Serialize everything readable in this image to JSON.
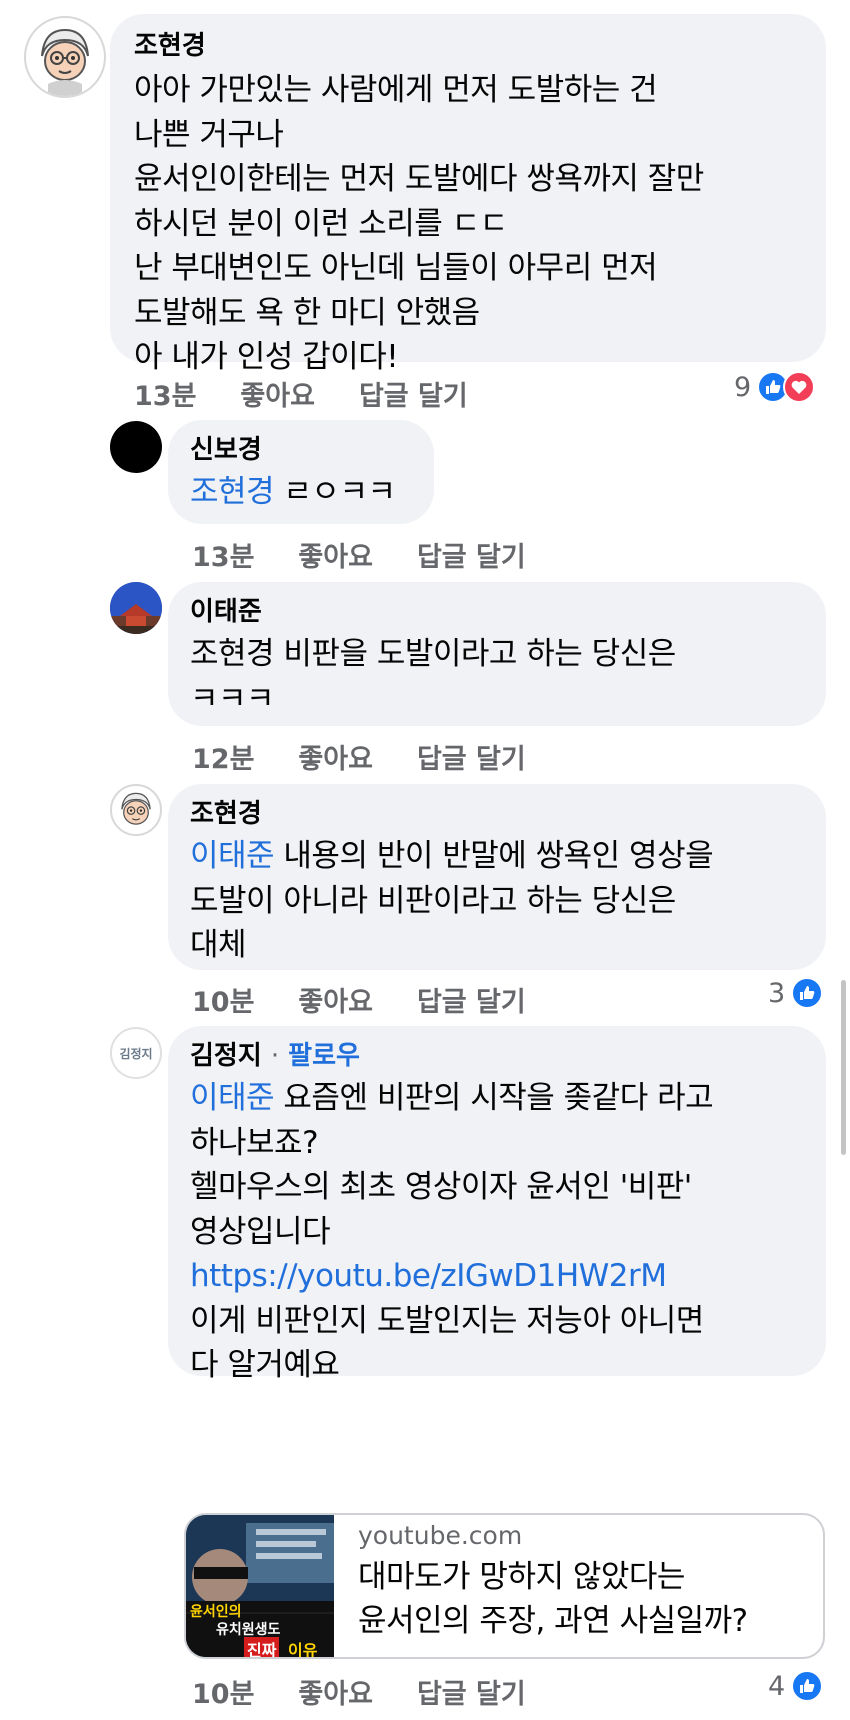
{
  "comments": [
    {
      "author": "조현경",
      "text": "아아 가만있는 사람에게 먼저 도발하는 건\n나쁜 거구나\n윤서인이한테는 먼저 도발에다 쌍욕까지 잘만\n하시던 분이 이런 소리를 ㄷㄷ\n난 부대변인도 아닌데 님들이 아무리 먼저\n도발해도 욕 한 마디 안했음\n아 내가 인성 갑이다!",
      "time": "13분",
      "like": "좋아요",
      "reply": "답글 달기",
      "reactions_count": "9"
    },
    {
      "author": "신보경",
      "mention": "조현경",
      "text": " ㄹㅇㅋㅋ",
      "time": "13분",
      "like": "좋아요",
      "reply": "답글 달기"
    },
    {
      "author": "이태준",
      "text": "조현경 비판을 도발이라고 하는 당신은\nㅋㅋㅋ",
      "time": "12분",
      "like": "좋아요",
      "reply": "답글 달기"
    },
    {
      "author": "조현경",
      "mention": "이태준",
      "text": " 내용의 반이 반말에 쌍욕인 영상을\n도발이 아니라 비판이라고 하는 당신은\n대체",
      "time": "10분",
      "like": "좋아요",
      "reply": "답글 달기",
      "reactions_count": "3"
    },
    {
      "author": "김정지",
      "separator": "·",
      "follow": "팔로우",
      "avatar_text": "김정지",
      "mention": "이태준",
      "text": " 요즘엔 비판의 시작을 좆같다 라고\n하나보죠?\n헬마우스의 최초 영상이자 윤서인 '비판'\n영상입니다",
      "link": "https://youtu.be/zIGwD1HW2rM",
      "text2": "이게 비판인지 도발인지는 저능아 아니면\n다 알거예요",
      "preview": {
        "domain": "youtube.com",
        "title": "대마도가 망하지 않았다는\n윤서인의 주장, 과연 사실일까?",
        "thumb_texts": [
          "윤서인의",
          "유치원생도",
          "진짜",
          "이유"
        ]
      },
      "time": "10분",
      "like": "좋아요",
      "reply": "답글 달기",
      "reactions_count": "4"
    }
  ],
  "colors": {
    "mention": "#216fdb",
    "like": "#1877f2",
    "love": "#f33e58",
    "bubble": "#f0f2f5",
    "meta": "#65676b"
  },
  "icons": [
    "like-reaction-icon",
    "love-reaction-icon"
  ]
}
